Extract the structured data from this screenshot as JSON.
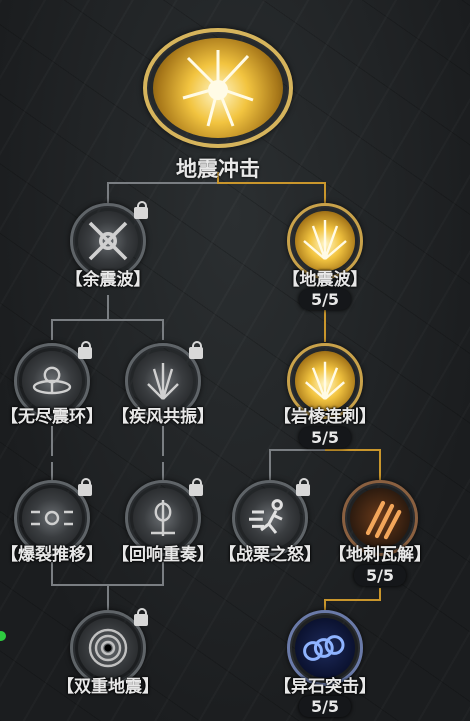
{
  "root": {
    "label": "地震冲击"
  },
  "nodes": {
    "n1": {
      "label": "【余震波】"
    },
    "n2": {
      "label": "【地震波】",
      "count": "5/5"
    },
    "n3": {
      "label": "【无尽震环】"
    },
    "n4": {
      "label": "【疾风共振】"
    },
    "n5": {
      "label": "【岩棱连刺】",
      "count": "5/5"
    },
    "n6": {
      "label": "【爆裂推移】"
    },
    "n7": {
      "label": "【回响重奏】"
    },
    "n8": {
      "label": "【战栗之怒】"
    },
    "n9": {
      "label": "【地刺瓦解】",
      "count": "5/5"
    },
    "n10": {
      "label": "【双重地震】"
    },
    "n11": {
      "label": "【异石突击】",
      "count": "5/5"
    }
  },
  "colors": {
    "active_line": "#c9962c",
    "inactive_line": "#7a7e82",
    "gold": "#f2c440"
  }
}
